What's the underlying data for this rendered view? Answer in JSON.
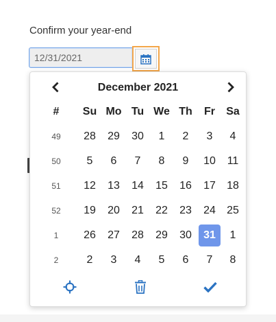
{
  "form": {
    "label": "Confirm your year-end",
    "value": "12/31/2021"
  },
  "calendar": {
    "month_title": "December 2021",
    "headers": [
      "#",
      "Su",
      "Mo",
      "Tu",
      "We",
      "Th",
      "Fr",
      "Sa"
    ],
    "weeks": [
      {
        "num": "49",
        "days": [
          {
            "d": "28",
            "cur": false
          },
          {
            "d": "29",
            "cur": false
          },
          {
            "d": "30",
            "cur": false
          },
          {
            "d": "1",
            "cur": true
          },
          {
            "d": "2",
            "cur": true
          },
          {
            "d": "3",
            "cur": true
          },
          {
            "d": "4",
            "cur": true
          }
        ]
      },
      {
        "num": "50",
        "days": [
          {
            "d": "5",
            "cur": true
          },
          {
            "d": "6",
            "cur": true
          },
          {
            "d": "7",
            "cur": true
          },
          {
            "d": "8",
            "cur": true
          },
          {
            "d": "9",
            "cur": true
          },
          {
            "d": "10",
            "cur": true
          },
          {
            "d": "11",
            "cur": true
          }
        ]
      },
      {
        "num": "51",
        "days": [
          {
            "d": "12",
            "cur": true
          },
          {
            "d": "13",
            "cur": true
          },
          {
            "d": "14",
            "cur": true
          },
          {
            "d": "15",
            "cur": true
          },
          {
            "d": "16",
            "cur": true
          },
          {
            "d": "17",
            "cur": true
          },
          {
            "d": "18",
            "cur": true
          }
        ]
      },
      {
        "num": "52",
        "days": [
          {
            "d": "19",
            "cur": true
          },
          {
            "d": "20",
            "cur": true
          },
          {
            "d": "21",
            "cur": true
          },
          {
            "d": "22",
            "cur": true
          },
          {
            "d": "23",
            "cur": true
          },
          {
            "d": "24",
            "cur": true
          },
          {
            "d": "25",
            "cur": true
          }
        ]
      },
      {
        "num": "1",
        "days": [
          {
            "d": "26",
            "cur": true
          },
          {
            "d": "27",
            "cur": true
          },
          {
            "d": "28",
            "cur": true
          },
          {
            "d": "29",
            "cur": true
          },
          {
            "d": "30",
            "cur": true
          },
          {
            "d": "31",
            "cur": true,
            "selected": true
          },
          {
            "d": "1",
            "cur": false
          }
        ]
      },
      {
        "num": "2",
        "days": [
          {
            "d": "2",
            "cur": false
          },
          {
            "d": "3",
            "cur": false
          },
          {
            "d": "4",
            "cur": false
          },
          {
            "d": "5",
            "cur": false
          },
          {
            "d": "6",
            "cur": false
          },
          {
            "d": "7",
            "cur": false
          },
          {
            "d": "8",
            "cur": false
          }
        ]
      }
    ],
    "footer_icons": [
      "crosshairs-icon",
      "trash-icon",
      "check-icon"
    ]
  },
  "colors": {
    "accent": "#2b73c2",
    "selected_bg": "#6f96ea",
    "focus_border": "#f3a64a"
  }
}
